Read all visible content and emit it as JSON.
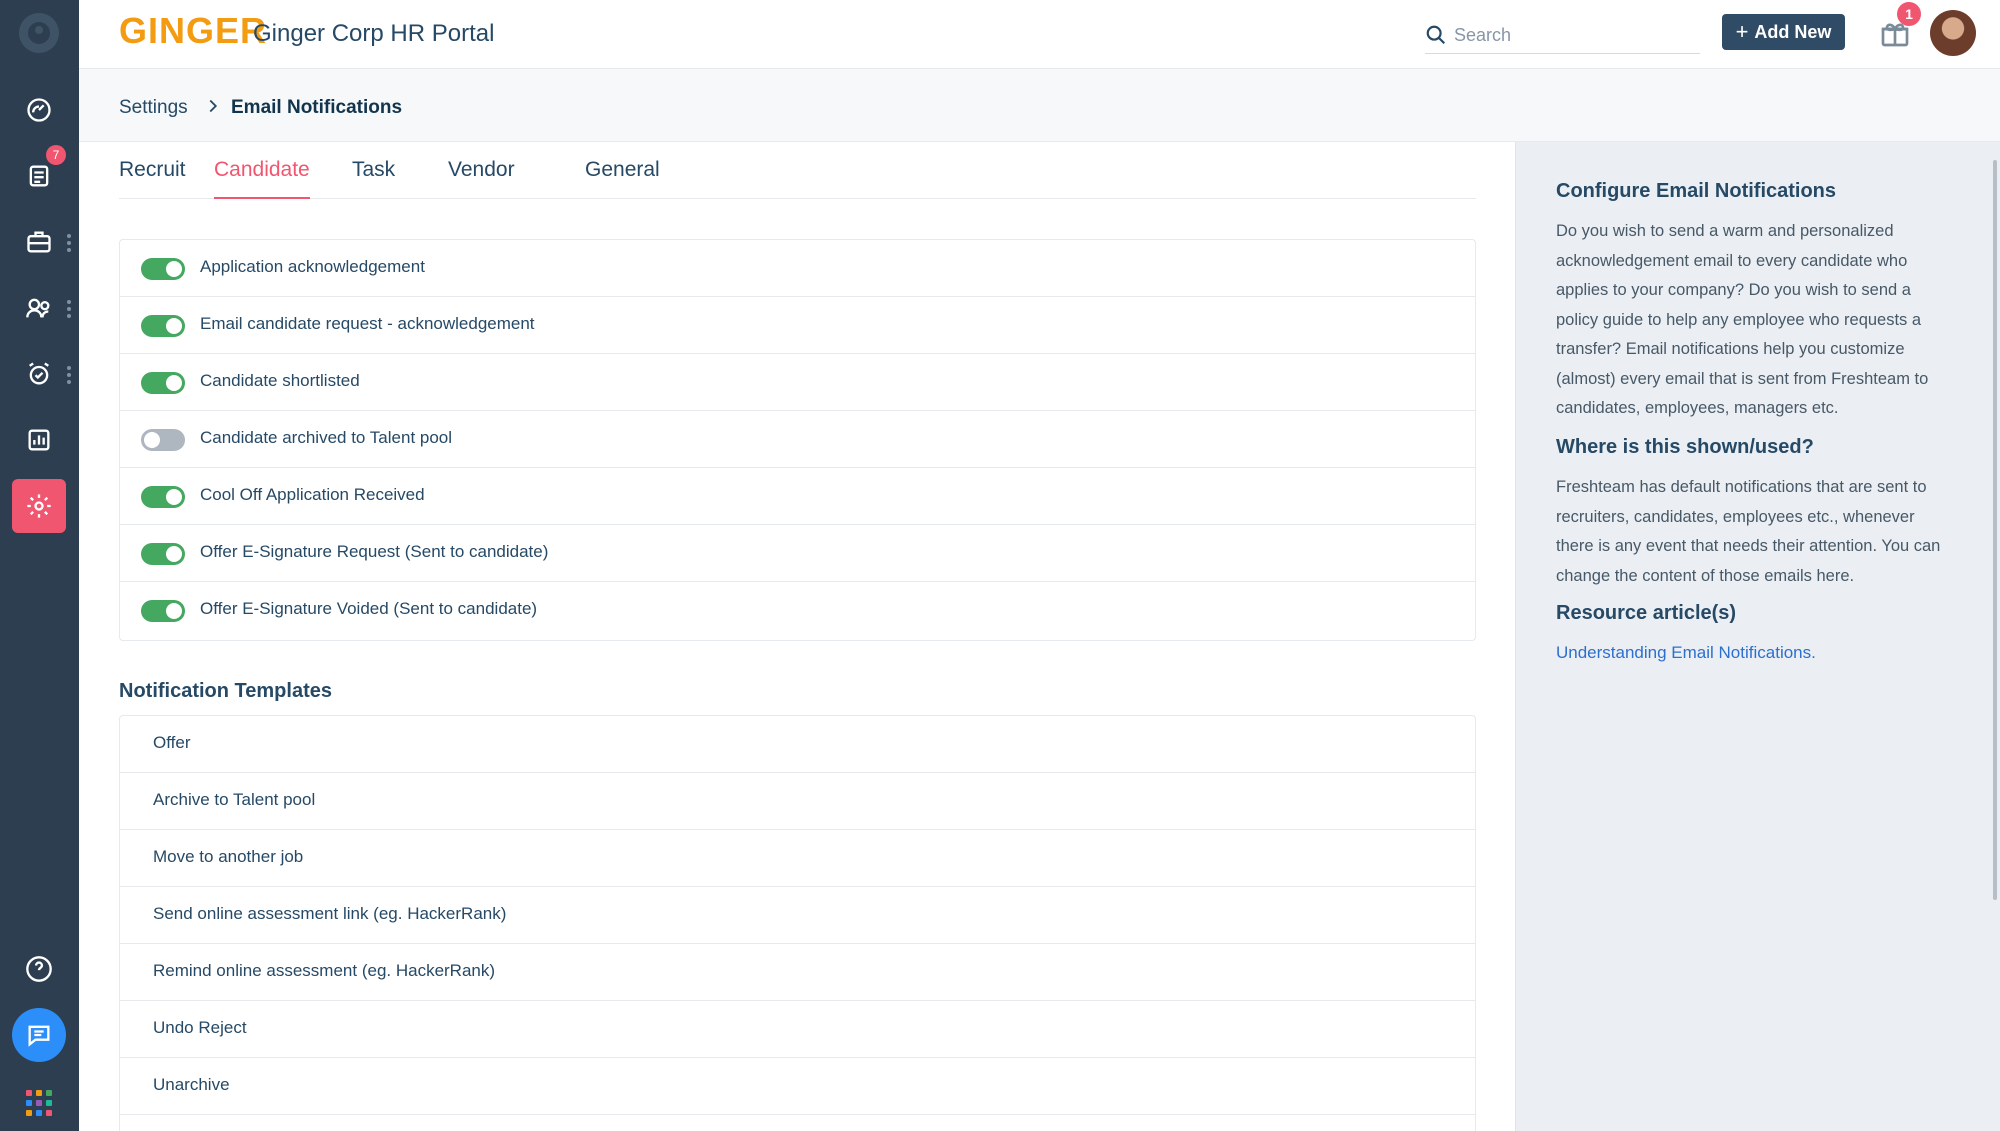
{
  "header": {
    "brand": "GINGER",
    "title": "Ginger Corp HR Portal",
    "search_placeholder": "Search",
    "add_new_label": "Add New",
    "add_new_icon": "plus-icon",
    "gift_count": "1"
  },
  "sidebar": {
    "items": [
      {
        "name": "dashboard",
        "icon": "gauge-icon"
      },
      {
        "name": "tasks",
        "icon": "checklist-icon",
        "badge": "7"
      },
      {
        "name": "jobs",
        "icon": "briefcase-icon"
      },
      {
        "name": "people",
        "icon": "people-icon"
      },
      {
        "name": "time-off",
        "icon": "alarm-icon"
      },
      {
        "name": "reports",
        "icon": "bar-chart-icon"
      },
      {
        "name": "settings",
        "icon": "gear-icon"
      }
    ],
    "bottom": [
      "help-icon",
      "chat-icon",
      "apps-grid-icon"
    ],
    "accent": "#f0566f"
  },
  "breadcrumb": {
    "root": "Settings",
    "current": "Email Notifications"
  },
  "tabs": [
    {
      "label": "Recruit",
      "active": false
    },
    {
      "label": "Candidate",
      "active": true
    },
    {
      "label": "Task",
      "active": false
    },
    {
      "label": "Vendor",
      "active": false
    },
    {
      "label": "General",
      "active": false
    }
  ],
  "notifications": [
    {
      "label": "Application acknowledgement",
      "enabled": true
    },
    {
      "label": "Email candidate request - acknowledgement",
      "enabled": true
    },
    {
      "label": "Candidate shortlisted",
      "enabled": true
    },
    {
      "label": "Candidate archived to Talent pool",
      "enabled": false
    },
    {
      "label": "Cool Off Application Received",
      "enabled": true
    },
    {
      "label": "Offer E-Signature Request (Sent to candidate)",
      "enabled": true
    },
    {
      "label": "Offer E-Signature Voided (Sent to candidate)",
      "enabled": true
    }
  ],
  "templates": {
    "title": "Notification Templates",
    "items": [
      "Offer",
      "Archive to Talent pool",
      "Move to another job",
      "Send online assessment link (eg. HackerRank)",
      "Remind online assessment (eg. HackerRank)",
      "Undo Reject",
      "Unarchive"
    ]
  },
  "info_panel": {
    "title": "Configure Email Notifications",
    "body": "Do you wish to send a warm and personalized acknowledgement email to every candidate who applies to your company? Do you wish to send a policy guide to help any employee who requests a transfer? Email notifications help you customize (almost) every email that is sent from Freshteam to candidates, employees, managers etc.",
    "where_title": "Where is this shown/used?",
    "where_body": "Freshteam has default notifications that are sent to recruiters, candidates, employees etc., whenever there is any event that needs their attention. You can change the content of those emails here.",
    "resource_title": "Resource article(s)",
    "resource_link": "Understanding Email Notifications."
  },
  "colors": {
    "switch_on": "#44a860",
    "switch_off": "#aeb6bf",
    "tab_active": "#f0566f",
    "button": "#2f4b65",
    "sidebar_bg": "#2c3e50",
    "chat_button": "#2c8ef8"
  }
}
